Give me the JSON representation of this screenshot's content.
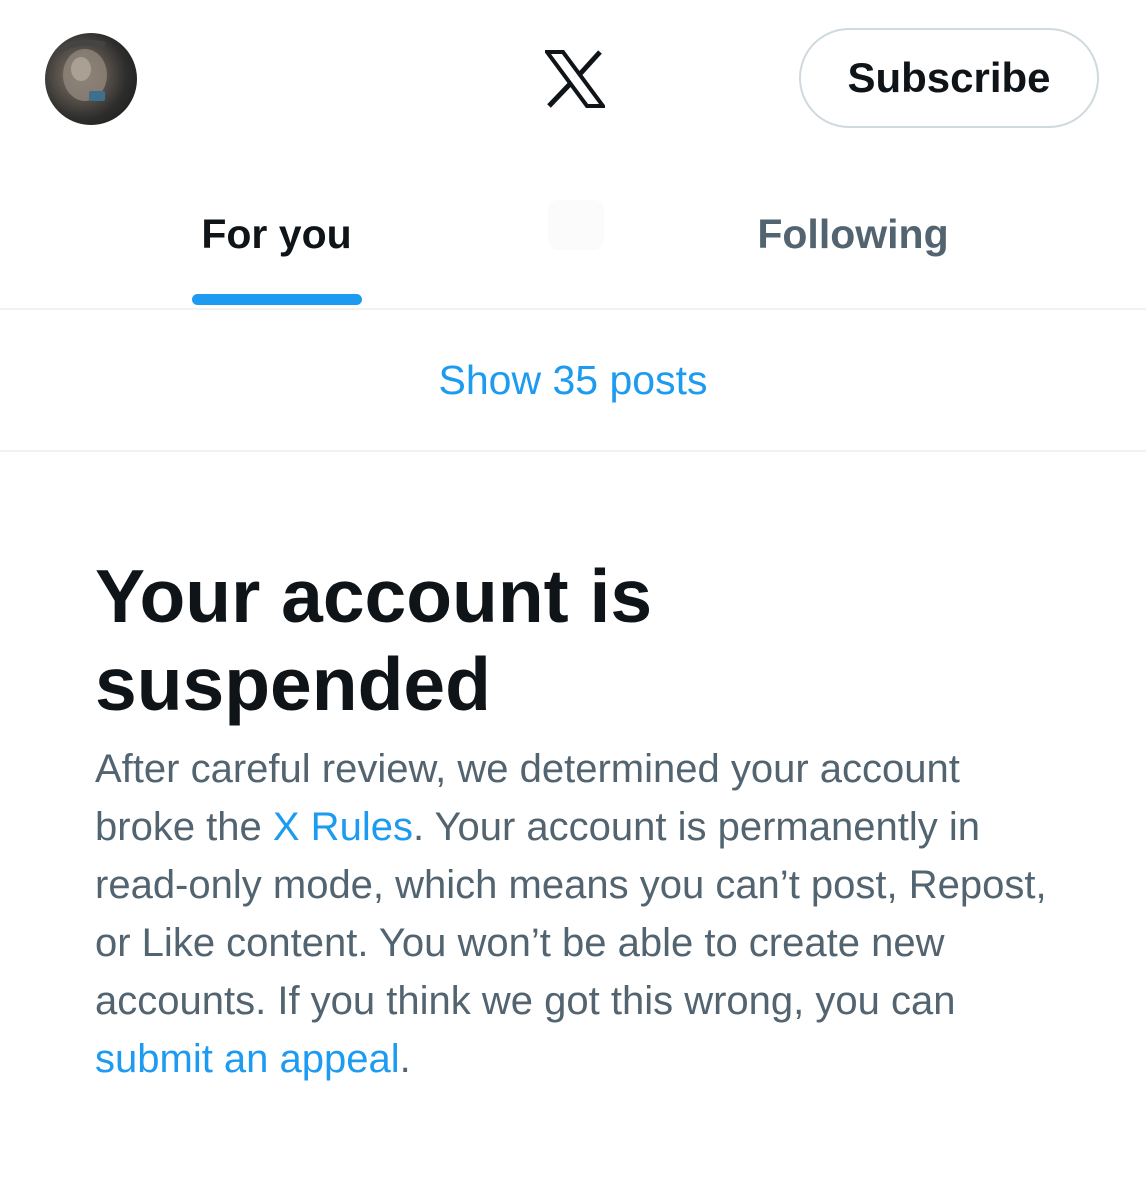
{
  "header": {
    "logo_icon": "x-logo-icon",
    "subscribe_label": "Subscribe"
  },
  "tabs": [
    {
      "label": "For you",
      "active": true
    },
    {
      "label": "Following",
      "active": false
    }
  ],
  "feed": {
    "show_posts_label": "Show 35 posts"
  },
  "suspension": {
    "title": "Your account is suspended",
    "body": {
      "part1": "After careful review, we determined your account broke the ",
      "rules_link": "X Rules",
      "part2": ". Your account is permanently in read-only mode, which means you can’t post, Repost, or Like content. You won’t be able to create new accounts. If you think we got this wrong, you can ",
      "appeal_link": "submit an appeal",
      "part3": "."
    }
  },
  "colors": {
    "accent": "#1d9bf0",
    "text_primary": "#0f1419",
    "text_secondary": "#536471",
    "border": "#cfd9de"
  }
}
